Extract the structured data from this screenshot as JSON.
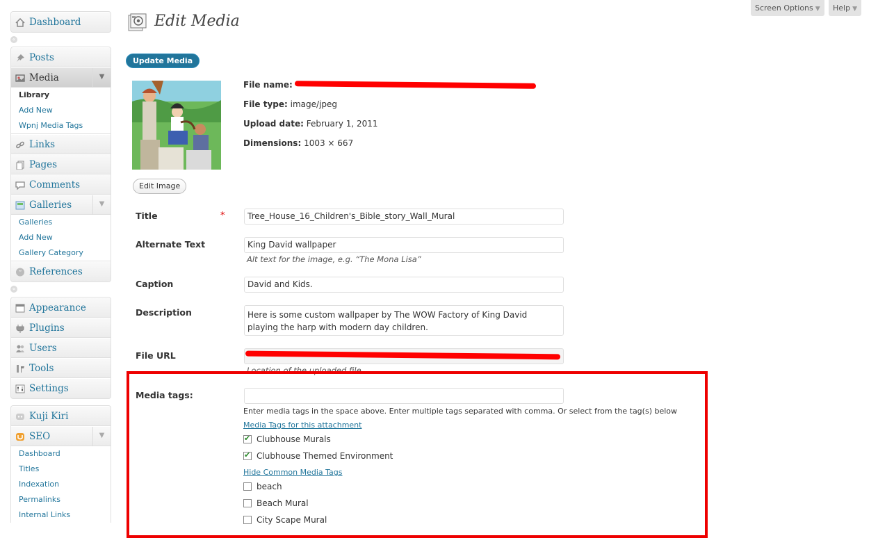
{
  "header": {
    "screen_options_label": "Screen Options",
    "help_label": "Help",
    "page_title": "Edit Media",
    "update_button_label": "Update Media"
  },
  "sidebar": {
    "dashboard": "Dashboard",
    "posts": "Posts",
    "media": "Media",
    "media_submenu": [
      "Library",
      "Add New",
      "Wpnj Media Tags"
    ],
    "links": "Links",
    "pages": "Pages",
    "comments": "Comments",
    "galleries": "Galleries",
    "galleries_submenu": [
      "Galleries",
      "Add New",
      "Gallery Category"
    ],
    "references": "References",
    "appearance": "Appearance",
    "plugins": "Plugins",
    "users": "Users",
    "tools": "Tools",
    "settings": "Settings",
    "kuji_kiri": "Kuji Kiri",
    "seo": "SEO",
    "seo_submenu": [
      "Dashboard",
      "Titles",
      "Indexation",
      "Permalinks",
      "Internal Links"
    ]
  },
  "attachment": {
    "file_name_label": "File name:",
    "file_type_label": "File type:",
    "file_type": "image/jpeg",
    "upload_date_label": "Upload date:",
    "upload_date": "February 1, 2011",
    "dimensions_label": "Dimensions:",
    "dimensions": "1003 × 667",
    "edit_image_label": "Edit Image"
  },
  "form": {
    "title_label": "Title",
    "required_marker": "*",
    "title_value": "Tree_House_16_Children's_Bible_story_Wall_Mural",
    "alt_label": "Alternate Text",
    "alt_value": "King David wallpaper",
    "alt_help": "Alt text for the image, e.g. “The Mona Lisa”",
    "caption_label": "Caption",
    "caption_value": "David and Kids.",
    "description_label": "Description",
    "description_value": "Here is some custom wallpaper by The WOW Factory of King David playing the harp with modern day children.",
    "file_url_label": "File URL",
    "file_url_help": "Location of the uploaded file."
  },
  "media_tags": {
    "label": "Media tags:",
    "input_value": "",
    "help": "Enter media tags in the space above. Enter multiple tags separated with comma. Or select from the tag(s) below",
    "attachment_tags_link": "Media Tags for this attachment",
    "attachment_tags": [
      {
        "label": "Clubhouse Murals",
        "checked": true
      },
      {
        "label": "Clubhouse Themed Environment",
        "checked": true
      }
    ],
    "hide_common_link": "Hide Common Media Tags",
    "common_tags": [
      {
        "label": "beach",
        "checked": false
      },
      {
        "label": "Beach Mural",
        "checked": false
      },
      {
        "label": "City Scape Mural",
        "checked": false
      }
    ]
  },
  "colors": {
    "link": "#21759b",
    "highlight_box": "#ee0000",
    "redaction": "#ff0000"
  }
}
